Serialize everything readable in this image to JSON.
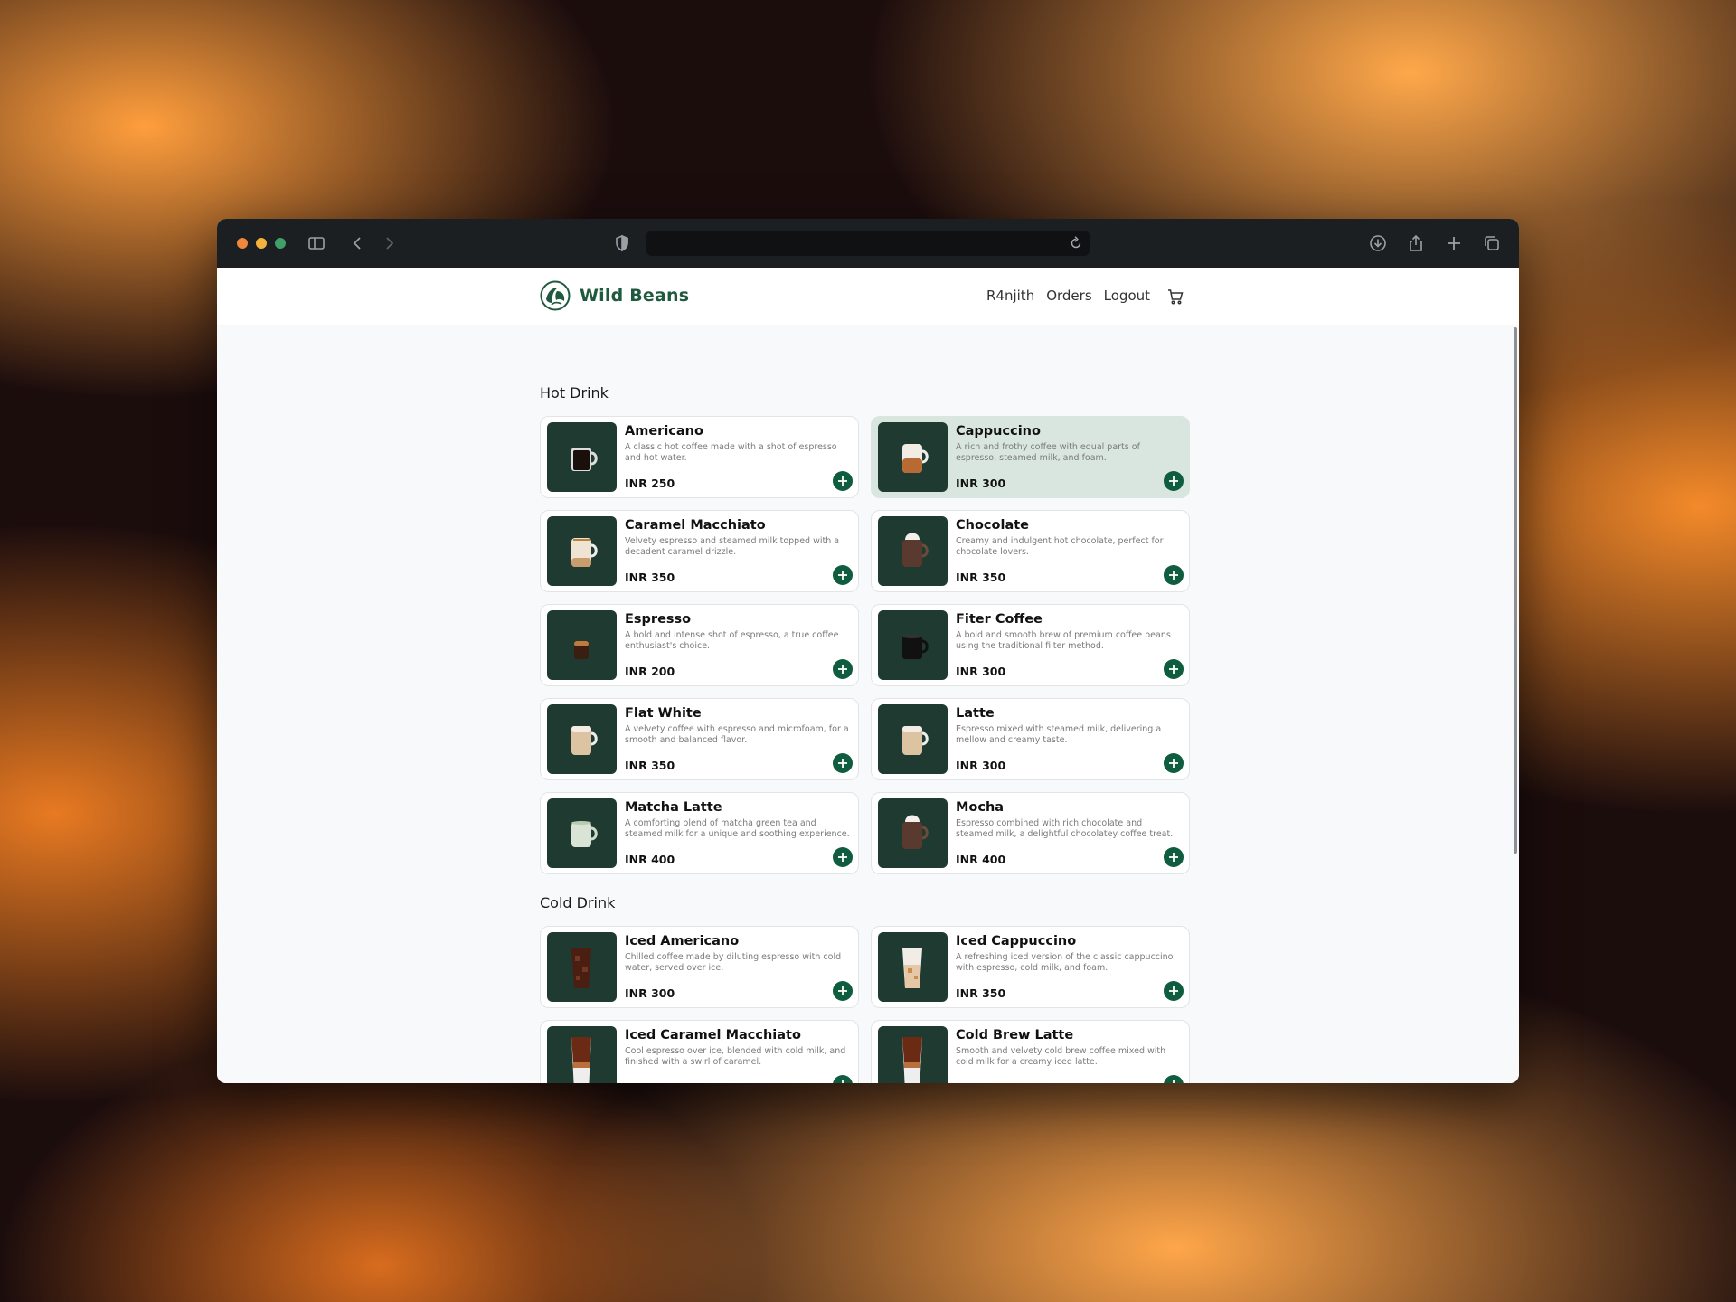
{
  "browser": {
    "traffic_lights": [
      "#f0873a",
      "#f3b13d",
      "#3fa06a"
    ],
    "icons": [
      "sidebar-icon",
      "back-icon",
      "forward-icon",
      "shield-icon",
      "reload-icon",
      "download-icon",
      "share-icon",
      "new-tab-icon",
      "tabs-icon"
    ]
  },
  "nav": {
    "brand": "Wild Beans",
    "user": "R4njith",
    "orders": "Orders",
    "logout": "Logout",
    "cart_icon": "cart-icon"
  },
  "colors": {
    "brand_green": "#1f5a3e",
    "button_green": "#0f5c3e",
    "highlight": "#d9e6df",
    "thumb_bg": "#1f3a31"
  },
  "sections": [
    {
      "title": "Hot Drink",
      "items": [
        {
          "name": "Americano",
          "desc": "A classic hot coffee made with a shot of espresso and hot water.",
          "price": "INR 250",
          "cup": "dark-mug"
        },
        {
          "name": "Cappuccino",
          "desc": "A rich and frothy coffee with equal parts of espresso, steamed milk, and foam.",
          "price": "INR 300",
          "cup": "glass-layered",
          "active": true
        },
        {
          "name": "Caramel Macchiato",
          "desc": "Velvety espresso and steamed milk topped with a decadent caramel drizzle.",
          "price": "INR 350",
          "cup": "glass-caramel"
        },
        {
          "name": "Chocolate",
          "desc": "Creamy and indulgent hot chocolate, perfect for chocolate lovers.",
          "price": "INR 350",
          "cup": "cream-mug"
        },
        {
          "name": "Espresso",
          "desc": "A bold and intense shot of espresso, a true coffee enthusiast's choice.",
          "price": "INR 200",
          "cup": "small-glass"
        },
        {
          "name": "Fiter Coffee",
          "desc": "A bold and smooth brew of premium coffee beans using the traditional filter method.",
          "price": "INR 300",
          "cup": "black-mug"
        },
        {
          "name": "Flat White",
          "desc": "A velvety coffee with espresso and microfoam, for a smooth and balanced flavor.",
          "price": "INR 350",
          "cup": "latte-glass"
        },
        {
          "name": "Latte",
          "desc": "Espresso mixed with steamed milk, delivering a mellow and creamy taste.",
          "price": "INR 300",
          "cup": "latte-glass"
        },
        {
          "name": "Matcha Latte",
          "desc": "A comforting blend of matcha green tea and steamed milk for a unique and soothing experience.",
          "price": "INR 400",
          "cup": "matcha-mug"
        },
        {
          "name": "Mocha",
          "desc": "Espresso combined with rich chocolate and steamed milk, a delightful chocolatey coffee treat.",
          "price": "INR 400",
          "cup": "cream-mug"
        }
      ]
    },
    {
      "title": "Cold Drink",
      "items": [
        {
          "name": "Iced Americano",
          "desc": "Chilled coffee made by diluting espresso with cold water, served over ice.",
          "price": "INR 300",
          "cup": "iced-dark"
        },
        {
          "name": "Iced Cappuccino",
          "desc": "A refreshing iced version of the classic cappuccino with espresso, cold milk, and foam.",
          "price": "INR 350",
          "cup": "iced-light"
        },
        {
          "name": "Iced Caramel Macchiato",
          "desc": "Cool espresso over ice, blended with cold milk, and finished with a swirl of caramel.",
          "price": "",
          "cup": "iced-layered"
        },
        {
          "name": "Cold Brew Latte",
          "desc": "Smooth and velvety cold brew coffee mixed with cold milk for a creamy iced latte.",
          "price": "",
          "cup": "iced-layered"
        }
      ]
    }
  ]
}
